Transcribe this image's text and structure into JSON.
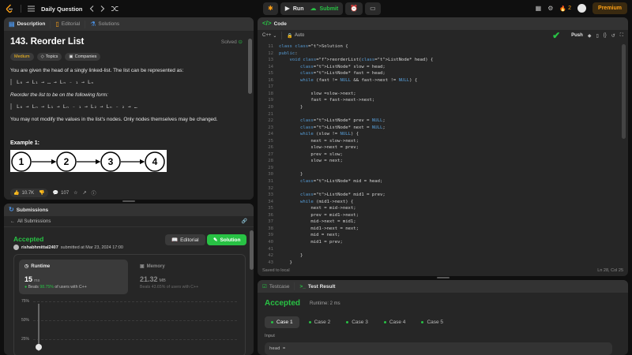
{
  "topbar": {
    "title": "Daily Question",
    "run_label": "Run",
    "submit_label": "Submit",
    "streak_count": "2",
    "premium_label": "Premium"
  },
  "description": {
    "tabs": [
      {
        "label": "Description"
      },
      {
        "label": "Editorial"
      },
      {
        "label": "Solutions"
      }
    ],
    "problem_title": "143. Reorder List",
    "solved_label": "Solved",
    "tags": [
      "Medium",
      "Topics",
      "Companies"
    ],
    "para1": "You are given the head of a singly linked-list. The list can be represented as:",
    "formula1": "L₀ → L₁ → … → Lₙ ₋ ₁ → Lₙ",
    "para2": "Reorder the list to be on the following form:",
    "formula2": "L₀ → Lₙ → L₁ → Lₙ ₋ ₁ → L₂ → Lₙ ₋ ₂ → …",
    "para3": "You may not modify the values in the list's nodes. Only nodes themselves may be changed.",
    "example_title": "Example 1:",
    "example_nodes": [
      "1",
      "2",
      "3",
      "4"
    ],
    "likes": "10.7K",
    "comments": "107"
  },
  "submissions": {
    "title": "Submissions",
    "back_label": "All Submissions",
    "status": "Accepted",
    "user": "rishabhmittal2407",
    "submitted_text": "submitted at Mar 23, 2024 17:00",
    "editorial_btn": "Editorial",
    "solution_btn": "Solution",
    "runtime": {
      "label": "Runtime",
      "value": "15",
      "unit": "ms",
      "beats_prefix": "Beats",
      "beats_pct": "98.75%",
      "beats_suffix": "of users with C++"
    },
    "memory": {
      "label": "Memory",
      "value": "21.32",
      "unit": "MB",
      "beats_text": "Beats 43.65% of users with C++"
    },
    "chart_ticks": [
      "75%",
      "50%",
      "25%"
    ]
  },
  "code": {
    "title": "Code",
    "language": "C++",
    "auto_label": "Auto",
    "push_label": "Push",
    "line_numbers": [
      "11",
      "12",
      "13",
      "14",
      "15",
      "16",
      "17",
      "18",
      "19",
      "20",
      "21",
      "22",
      "23",
      "24",
      "25",
      "26",
      "27",
      "28",
      "29",
      "30",
      "31",
      "32",
      "33",
      "34",
      "35",
      "36",
      "37",
      "38",
      "39",
      "40",
      "41",
      "42",
      "43"
    ],
    "lines": [
      "class Solution {",
      "public:",
      "    void reorderList(ListNode* head) {",
      "        ListNode* slow = head;",
      "        ListNode* fast = head;",
      "        while (fast != NULL && fast->next != NULL) {",
      "",
      "            slow =slow->next;",
      "            fast = fast->next->next;",
      "        }",
      "",
      "        ListNode* prev = NULL;",
      "        ListNode* next = NULL;",
      "        while (slow != NULL) {",
      "            next = slow->next;",
      "            slow->next = prev;",
      "            prev = slow;",
      "            slow = next;",
      "",
      "        }",
      "        ListNode* mid = head;",
      "",
      "        ListNode* mid1 = prev;",
      "        while (mid1->next) {",
      "            next = mid->next;",
      "            prev = mid1->next;",
      "            mid->next = mid1;",
      "            mid1->next = next;",
      "            mid = next;",
      "            mid1 = prev;",
      "",
      "        }",
      "    }"
    ],
    "saved_label": "Saved to local",
    "cursor_pos": "Ln 28, Col 25"
  },
  "test": {
    "tabs": [
      {
        "label": "Testcase"
      },
      {
        "label": "Test Result"
      }
    ],
    "status": "Accepted",
    "runtime_text": "Runtime: 2 ms",
    "cases": [
      "Case 1",
      "Case 2",
      "Case 3",
      "Case 4",
      "Case 5"
    ],
    "input_label": "Input",
    "input_value": "head ="
  }
}
